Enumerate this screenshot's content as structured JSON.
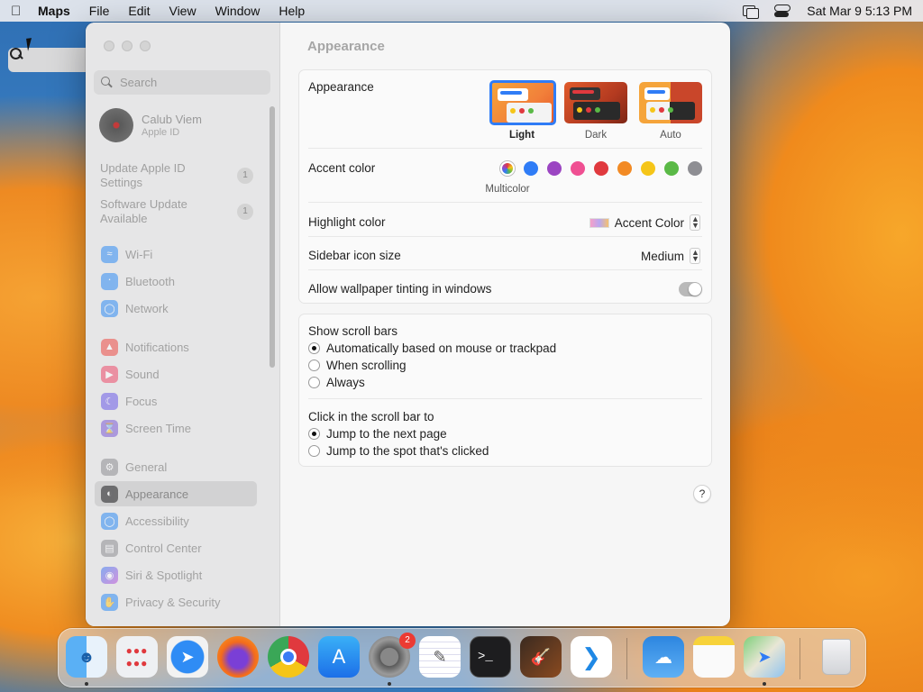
{
  "menubar": {
    "app": "Maps",
    "items": [
      "File",
      "Edit",
      "View",
      "Window",
      "Help"
    ],
    "datetime": "Sat Mar 9  5:13 PM"
  },
  "sidebar": {
    "search_placeholder": "Search",
    "user": {
      "name": "Calub Viem",
      "sub": "Apple ID"
    },
    "notices": [
      {
        "label": "Update Apple ID Settings",
        "badge": "1"
      },
      {
        "label": "Software Update Available",
        "badge": "1"
      }
    ],
    "items": [
      {
        "label": "Wi-Fi",
        "icon": "wifi-icon",
        "color": "#2f8cf5"
      },
      {
        "label": "Bluetooth",
        "icon": "bluetooth-icon",
        "color": "#2f8cf5"
      },
      {
        "label": "Network",
        "icon": "globe-icon",
        "color": "#2f8cf5"
      },
      {
        "label": "Notifications",
        "icon": "bell-icon",
        "color": "#ef4b45"
      },
      {
        "label": "Sound",
        "icon": "speaker-icon",
        "color": "#ef4b6a"
      },
      {
        "label": "Focus",
        "icon": "moon-icon",
        "color": "#6c5ce7"
      },
      {
        "label": "Screen Time",
        "icon": "hourglass-icon",
        "color": "#7b5cd6"
      },
      {
        "label": "General",
        "icon": "gear-icon",
        "color": "#8e8e93"
      },
      {
        "label": "Appearance",
        "icon": "appearance-icon",
        "color": "#1c1c1e"
      },
      {
        "label": "Accessibility",
        "icon": "accessibility-icon",
        "color": "#2f8cf5"
      },
      {
        "label": "Control Center",
        "icon": "control-center-icon",
        "color": "#8e8e93"
      },
      {
        "label": "Siri & Spotlight",
        "icon": "siri-icon",
        "color": "#c04fd8"
      },
      {
        "label": "Privacy & Security",
        "icon": "hand-icon",
        "color": "#2f8cf5"
      }
    ]
  },
  "main": {
    "title": "Appearance",
    "appearance_label": "Appearance",
    "modes": [
      "Light",
      "Dark",
      "Auto"
    ],
    "accent_label": "Accent color",
    "accent_selected_label": "Multicolor",
    "accent_colors": [
      "#2f7cf6",
      "#9b45c2",
      "#ef4f92",
      "#e0393e",
      "#f28a24",
      "#f5c518",
      "#5ab946",
      "#8e8e93"
    ],
    "highlight_label": "Highlight color",
    "highlight_value": "Accent Color",
    "sidebar_icon_label": "Sidebar icon size",
    "sidebar_icon_value": "Medium",
    "tinting_label": "Allow wallpaper tinting in windows",
    "scroll_label": "Show scroll bars",
    "scroll_options": [
      "Automatically based on mouse or trackpad",
      "When scrolling",
      "Always"
    ],
    "click_label": "Click in the scroll bar to",
    "click_options": [
      "Jump to the next page",
      "Jump to the spot that's clicked"
    ],
    "help": "?"
  },
  "dock": {
    "badge": "2",
    "apps": [
      "finder-icon",
      "launchpad-icon",
      "safari-icon",
      "firefox-icon",
      "chrome-icon",
      "app-store-icon",
      "system-settings-icon",
      "textedit-icon",
      "terminal-icon",
      "garageband-icon",
      "vscode-icon",
      "weather-icon",
      "notes-icon",
      "maps-icon",
      "trash-icon"
    ]
  }
}
